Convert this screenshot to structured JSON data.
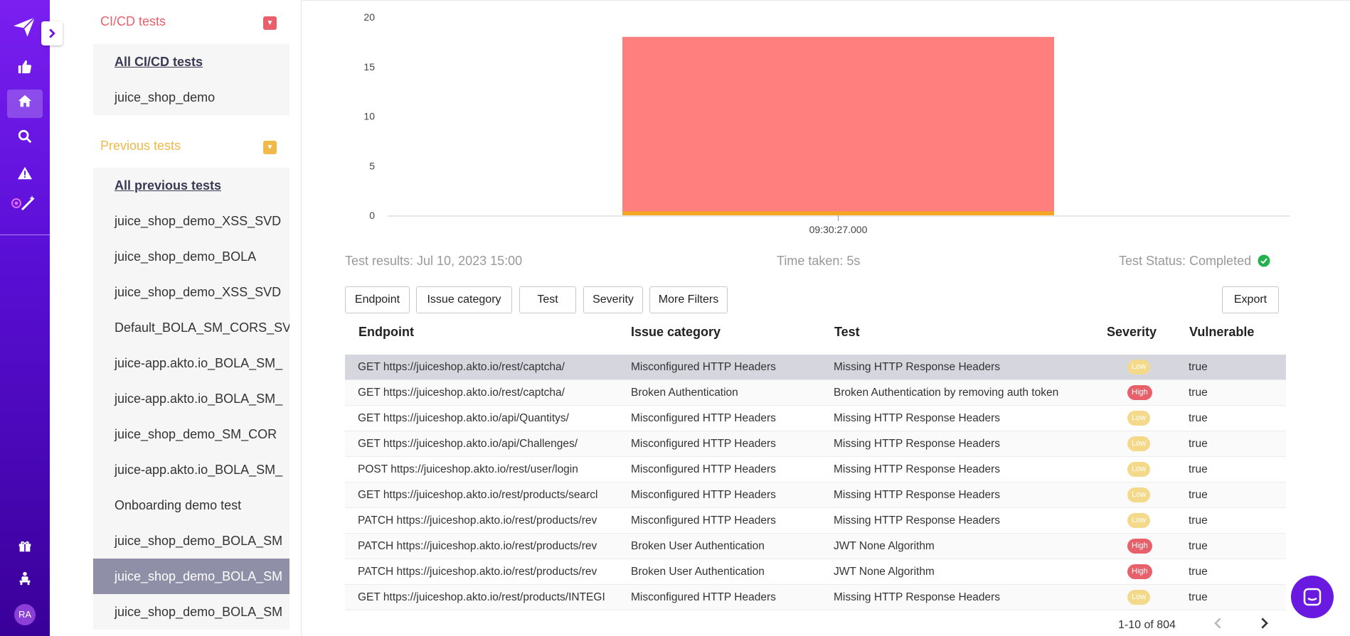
{
  "rail": {
    "avatar_initials": "RA"
  },
  "sidebar": {
    "cicd_title": "CI/CD tests",
    "cicd_items": [
      {
        "label": "All CI/CD tests"
      },
      {
        "label": "juice_shop_demo"
      }
    ],
    "previous_title": "Previous tests",
    "previous_items": [
      {
        "label": "All previous tests"
      },
      {
        "label": "juice_shop_demo_XSS_SVD"
      },
      {
        "label": "juice_shop_demo_BOLA"
      },
      {
        "label": "juice_shop_demo_XSS_SVD"
      },
      {
        "label": "Default_BOLA_SM_CORS_SV"
      },
      {
        "label": "juice-app.akto.io_BOLA_SM_"
      },
      {
        "label": "juice-app.akto.io_BOLA_SM_"
      },
      {
        "label": "juice_shop_demo_SM_COR"
      },
      {
        "label": "juice-app.akto.io_BOLA_SM_"
      },
      {
        "label": "Onboarding demo test"
      },
      {
        "label": "juice_shop_demo_BOLA_SM"
      },
      {
        "label": "juice_shop_demo_BOLA_SM"
      },
      {
        "label": "juice_shop_demo_BOLA_SM"
      }
    ],
    "colors": {
      "cicd": "#e8606a",
      "previous": "#f0b94a"
    }
  },
  "chart_data": {
    "type": "area",
    "x_label": "09:30:27.000",
    "y_ticks": [
      "20",
      "15",
      "10",
      "5",
      "0"
    ],
    "ylim": [
      0,
      20
    ],
    "series": [
      {
        "color": "#ff7f7f",
        "value": 18
      },
      {
        "color": "#f5a623",
        "value": 0.4
      }
    ]
  },
  "meta": {
    "results": "Test results: Jul 10, 2023 15:00",
    "time_taken": "Time taken: 5s",
    "status": "Test Status: Completed"
  },
  "filters": {
    "endpoint": "Endpoint",
    "issue_category": "Issue category",
    "test": "Test",
    "severity": "Severity",
    "more": "More Filters",
    "export": "Export"
  },
  "table": {
    "headers": [
      "Endpoint",
      "Issue category",
      "Test",
      "Severity",
      "Vulnerable"
    ],
    "rows": [
      {
        "endpoint": "GET https://juiceshop.akto.io/rest/captcha/",
        "category": "Misconfigured HTTP Headers",
        "test": "Missing HTTP Response Headers",
        "severity": "Low",
        "vulnerable": "true"
      },
      {
        "endpoint": "GET https://juiceshop.akto.io/rest/captcha/",
        "category": "Broken Authentication",
        "test": "Broken Authentication by removing auth token",
        "severity": "High",
        "vulnerable": "true"
      },
      {
        "endpoint": "GET https://juiceshop.akto.io/api/Quantitys/",
        "category": "Misconfigured HTTP Headers",
        "test": "Missing HTTP Response Headers",
        "severity": "Low",
        "vulnerable": "true"
      },
      {
        "endpoint": "GET https://juiceshop.akto.io/api/Challenges/",
        "category": "Misconfigured HTTP Headers",
        "test": "Missing HTTP Response Headers",
        "severity": "Low",
        "vulnerable": "true"
      },
      {
        "endpoint": "POST https://juiceshop.akto.io/rest/user/login",
        "category": "Misconfigured HTTP Headers",
        "test": "Missing HTTP Response Headers",
        "severity": "Low",
        "vulnerable": "true"
      },
      {
        "endpoint": "GET https://juiceshop.akto.io/rest/products/searcl",
        "category": "Misconfigured HTTP Headers",
        "test": "Missing HTTP Response Headers",
        "severity": "Low",
        "vulnerable": "true"
      },
      {
        "endpoint": "PATCH https://juiceshop.akto.io/rest/products/rev",
        "category": "Misconfigured HTTP Headers",
        "test": "Missing HTTP Response Headers",
        "severity": "Low",
        "vulnerable": "true"
      },
      {
        "endpoint": "PATCH https://juiceshop.akto.io/rest/products/rev",
        "category": "Broken User Authentication",
        "test": "JWT None Algorithm",
        "severity": "High",
        "vulnerable": "true"
      },
      {
        "endpoint": "PATCH https://juiceshop.akto.io/rest/products/rev",
        "category": "Broken User Authentication",
        "test": "JWT None Algorithm",
        "severity": "High",
        "vulnerable": "true"
      },
      {
        "endpoint": "GET https://juiceshop.akto.io/rest/products/INTEGI",
        "category": "Misconfigured HTTP Headers",
        "test": "Missing HTTP Response Headers",
        "severity": "Low",
        "vulnerable": "true"
      }
    ]
  },
  "pagination": {
    "range": "1-10 of 804"
  }
}
